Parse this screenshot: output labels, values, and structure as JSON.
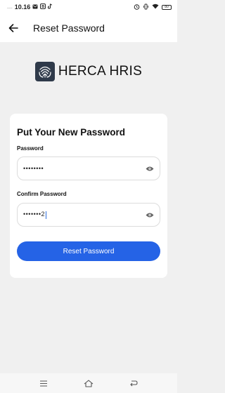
{
  "status_bar": {
    "time": "10.16",
    "icons": [
      "signal-dots-icon",
      "mail-icon",
      "b-app-icon",
      "tiktok-icon"
    ],
    "right_icons": [
      "alarm-icon",
      "vibrate-icon",
      "wifi-icon",
      "battery-icon"
    ],
    "battery_level": "80"
  },
  "header": {
    "back_icon": "arrow-left-icon",
    "title": "Reset Password"
  },
  "logo": {
    "text": "HERCA HRIS"
  },
  "form": {
    "title": "Put Your New Password",
    "password_label": "Password",
    "password_value": "••••••••",
    "confirm_label": "Confirm Password",
    "confirm_value": "•••••••2",
    "submit_label": "Reset Password"
  },
  "colors": {
    "accent": "#2563e6",
    "logo_bg": "#2f3a4a"
  }
}
